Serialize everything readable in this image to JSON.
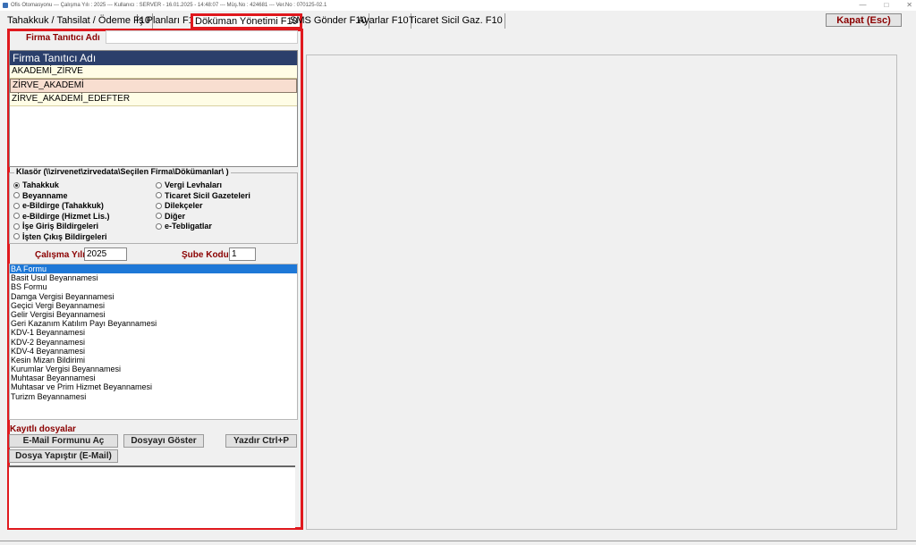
{
  "window": {
    "title": "Ofis Otomasyonu  ---  Çalışma Yılı : 2025  ---  Kullanıcı : SERVER - 16.01.2025 - 14:48:07  ---  Müş.No : 424681  ---  Ver.No : 070125-02.1",
    "controls": [
      "—",
      "□",
      "✕"
    ]
  },
  "tabs": [
    {
      "label": "Tahakkuk / Tahsilat / Ödeme F10"
    },
    {
      "label": "İş Planları F10"
    },
    {
      "label": "Döküman Yönetimi F10",
      "active": true
    },
    {
      "label": "SMS Gönder F10"
    },
    {
      "label": "Ayarlar F10"
    },
    {
      "label": "Ticaret Sicil Gaz. F10"
    }
  ],
  "close_button": "Kapat (Esc)",
  "firm_filter": {
    "label": "Firma Tanıtıcı Adı",
    "value": ""
  },
  "firm_list": {
    "header": "Firma Tanıtıcı Adı",
    "rows": [
      "AKADEMİ_ZİRVE",
      "ZİRVE_AKADEMİ",
      "ZİRVE_AKADEMİ_EDEFTER"
    ],
    "selected_index": 1
  },
  "folder_group": {
    "title": "Klasör (\\\\zirvenet\\zirvedata\\Seçilen Firma\\Dökümanlar\\ )",
    "options_left": [
      "Tahakkuk",
      "Beyanname",
      "e-Bildirge (Tahakkuk)",
      "e-Bildirge (Hizmet Lis.)",
      "İşe Giriş Bildirgeleri",
      "İşten Çıkış Bildirgeleri"
    ],
    "options_right": [
      "Vergi Levhaları",
      "Ticaret Sicil Gazeteleri",
      "Dilekçeler",
      "Diğer",
      "e-Tebligatlar"
    ],
    "selected": "Tahakkuk"
  },
  "work_year": {
    "label": "Çalışma Yılı",
    "value": "2025"
  },
  "branch_code": {
    "label": "Şube Kodu",
    "value": "1"
  },
  "document_types": {
    "items": [
      "BA Formu",
      "Basit Usul Beyannamesi",
      "BS Formu",
      "Damga Vergisi Beyannamesi",
      "Geçici Vergi Beyannamesi",
      "Gelir Vergisi Beyannamesi",
      "Geri Kazanım Katılım Payı Beyannamesi",
      "KDV-1 Beyannamesi",
      "KDV-2 Beyannamesi",
      "KDV-4 Beyannamesi",
      "Kesin Mizan Bildirimi",
      "Kurumlar Vergisi Beyannamesi",
      "Muhtasar Beyannamesi",
      "Muhtasar ve Prim Hizmet Beyannamesi",
      "Turizm Beyannamesi"
    ],
    "selected_index": 0
  },
  "saved_files": {
    "label": "Kayıtlı dosyalar"
  },
  "buttons": {
    "email_form": "E-Mail Formunu Aç",
    "show_file": "Dosyayı Göster",
    "print": "Yazdır Ctrl+P",
    "paste_file": "Dosya Yapıştır (E-Mail)"
  },
  "colors": {
    "accent_red": "#e0191e",
    "label_red": "#8b0000",
    "header_blue": "#2b3f6b",
    "selection_blue": "#1e78d7"
  }
}
